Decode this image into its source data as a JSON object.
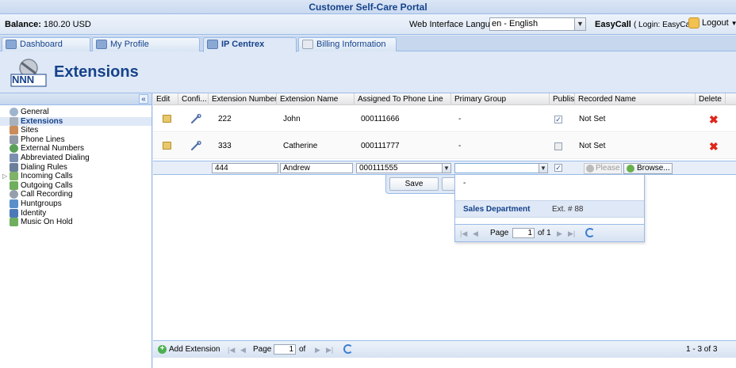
{
  "app": {
    "title": "Customer Self-Care Portal"
  },
  "topbar": {
    "balance_label": "Balance:",
    "balance_value": "180.20 USD",
    "language_label": "Web Interface Language:",
    "language_value": "en - English",
    "account_name": "EasyCall",
    "login_text": "( Login: EasyCall )",
    "logout_label": "Logout"
  },
  "tabs": [
    {
      "label": "Dashboard",
      "active": false
    },
    {
      "label": "My Profile",
      "active": false
    },
    {
      "label": "IP Centrex",
      "active": true
    },
    {
      "label": "Billing Information",
      "active": false
    }
  ],
  "page": {
    "logo_text": "NNN",
    "title": "Extensions"
  },
  "sidebar": {
    "collapse_label": "«",
    "items": [
      {
        "label": "General",
        "icon": "gear-icon"
      },
      {
        "label": "Extensions",
        "icon": "extensions-icon",
        "active": true
      },
      {
        "label": "Sites",
        "icon": "sites-icon"
      },
      {
        "label": "Phone Lines",
        "icon": "phone-lines-icon"
      },
      {
        "label": "External Numbers",
        "icon": "external-numbers-icon"
      },
      {
        "label": "Abbreviated Dialing",
        "icon": "abbreviated-dialing-icon"
      },
      {
        "label": "Dialing Rules",
        "icon": "dialing-rules-icon"
      },
      {
        "label": "Incoming Calls",
        "icon": "incoming-calls-icon",
        "expandable": true
      },
      {
        "label": "Outgoing Calls",
        "icon": "outgoing-calls-icon"
      },
      {
        "label": "Call Recording",
        "icon": "call-recording-icon"
      },
      {
        "label": "Huntgroups",
        "icon": "huntgroups-icon"
      },
      {
        "label": "Identity",
        "icon": "identity-icon"
      },
      {
        "label": "Music On Hold",
        "icon": "music-on-hold-icon"
      }
    ]
  },
  "grid": {
    "columns": [
      "Edit",
      "Confi...",
      "Extension Number",
      "Extension Name",
      "Assigned To Phone Line",
      "Primary Group",
      "Publis...",
      "Recorded Name",
      "Delete"
    ],
    "rows": [
      {
        "number": "222",
        "name": "John",
        "line": "000111666",
        "group": "-",
        "published": true,
        "recorded": "Not Set"
      },
      {
        "number": "333",
        "name": "Catherine",
        "line": "000111777",
        "group": "-",
        "published": false,
        "recorded": "Not Set"
      }
    ],
    "edit_row": {
      "number": "444",
      "name": "Andrew",
      "line": "000111555",
      "group": "",
      "please_placeholder": "Please",
      "browse_label": "Browse..."
    },
    "save_label": "Save"
  },
  "group_dropdown": {
    "options": [
      {
        "label": "-"
      },
      {
        "label": "Sales Department",
        "ext": "Ext. # 88",
        "selected": true
      }
    ],
    "paging": {
      "page_label": "Page",
      "page_value": "1",
      "of_label": "of 1"
    }
  },
  "footer": {
    "add_label": "Add Extension",
    "page_label": "Page",
    "page_value": "1",
    "of_label": "of",
    "summary": "1 - 3 of 3"
  },
  "colors": {
    "accent": "#15428b",
    "panel": "#dfe8f6",
    "border": "#99bbe8",
    "delete": "#e0261a"
  }
}
